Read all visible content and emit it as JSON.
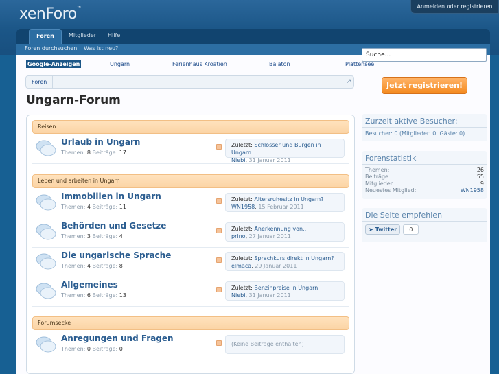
{
  "header": {
    "logo": "xenForo",
    "logo_mark": "™",
    "login_link": "Anmelden oder registrieren"
  },
  "nav": {
    "tabs": [
      {
        "label": "Foren"
      },
      {
        "label": "Mitglieder"
      },
      {
        "label": "Hilfe"
      }
    ],
    "sublinks": [
      "Foren durchsuchen",
      "Was ist neu?"
    ]
  },
  "search": {
    "value": "Suche..."
  },
  "ads": {
    "label": "Google-Anzeigen",
    "links": [
      "Ungarn",
      "Ferienhaus Kroatien",
      "Balaton",
      "Plattensee"
    ]
  },
  "breadcrumb": {
    "items": [
      "Foren"
    ]
  },
  "page_title": "Ungarn-Forum",
  "categories": [
    {
      "name": "Reisen",
      "forums": [
        {
          "title": "Urlaub in Ungarn",
          "themes_label": "Themen:",
          "themes": "8",
          "posts_label": "Beiträge:",
          "posts": "17",
          "last_prefix": "Zuletzt:",
          "last_title": "Schlösser und Burgen in Ungarn",
          "last_user": "Niebi",
          "last_date": "31 Januar 2011"
        }
      ]
    },
    {
      "name": "Leben und arbeiten in Ungarn",
      "forums": [
        {
          "title": "Immobilien in Ungarn",
          "themes_label": "Themen:",
          "themes": "4",
          "posts_label": "Beiträge:",
          "posts": "11",
          "last_prefix": "Zuletzt:",
          "last_title": "Altersruhesitz in Ungarn?",
          "last_user": "WN1958",
          "last_date": "15 Februar 2011"
        },
        {
          "title": "Behörden und Gesetze",
          "themes_label": "Themen:",
          "themes": "3",
          "posts_label": "Beiträge:",
          "posts": "4",
          "last_prefix": "Zuletzt:",
          "last_title": "Anerkennung von...",
          "last_user": "prino",
          "last_date": "27 Januar 2011"
        },
        {
          "title": "Die ungarische Sprache",
          "themes_label": "Themen:",
          "themes": "4",
          "posts_label": "Beiträge:",
          "posts": "8",
          "last_prefix": "Zuletzt:",
          "last_title": "Sprachkurs direkt in Ungarn?",
          "last_user": "elmaca",
          "last_date": "29 Januar 2011"
        },
        {
          "title": "Allgemeines",
          "themes_label": "Themen:",
          "themes": "6",
          "posts_label": "Beiträge:",
          "posts": "13",
          "last_prefix": "Zuletzt:",
          "last_title": "Benzinpreise in Ungarn",
          "last_user": "Niebi",
          "last_date": "31 Januar 2011"
        }
      ]
    },
    {
      "name": "Forumsecke",
      "forums": [
        {
          "title": "Anregungen und Fragen",
          "themes_label": "Themen:",
          "themes": "0",
          "posts_label": "Beiträge:",
          "posts": "0",
          "empty_text": "(Keine Beiträge enthalten)"
        }
      ]
    }
  ],
  "sidebar": {
    "register_button": "Jetzt registrieren!",
    "visitors": {
      "title": "Zurzeit aktive Besucher:",
      "line": "Besucher: 0 (Mitglieder: 0, Gäste: 0)"
    },
    "stats": {
      "title": "Forenstatistik",
      "rows": [
        {
          "label": "Themen:",
          "value": "26"
        },
        {
          "label": "Beiträge:",
          "value": "55"
        },
        {
          "label": "Mitglieder:",
          "value": "9"
        },
        {
          "label": "Neuestes Mitglied:",
          "value": "WN1958"
        }
      ]
    },
    "share": {
      "title": "Die Seite empfehlen",
      "twitter_label": "Twitter",
      "twitter_count": "0"
    }
  },
  "colors": {
    "header": "#1b5687",
    "category": "#fbd4a5",
    "accent": "#f48a1f",
    "link": "#2b5d90"
  }
}
